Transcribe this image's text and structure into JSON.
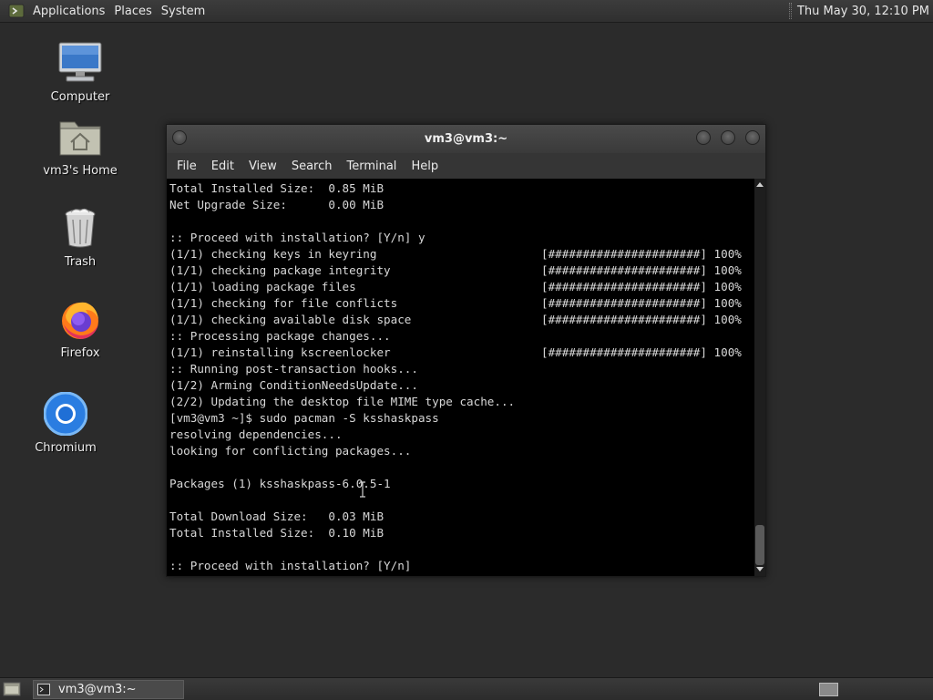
{
  "top_panel": {
    "menus": [
      "Applications",
      "Places",
      "System"
    ],
    "clock": "Thu May 30, 12:10 PM"
  },
  "desktop": {
    "icons": [
      {
        "label": "Computer",
        "icon": "computer-icon"
      },
      {
        "label": "vm3's Home",
        "icon": "home-folder-icon"
      },
      {
        "label": "Trash",
        "icon": "trash-icon"
      },
      {
        "label": "Firefox",
        "icon": "firefox-icon"
      },
      {
        "label": "Chromium",
        "icon": "chromium-icon"
      }
    ]
  },
  "window": {
    "title": "vm3@vm3:~",
    "menu": [
      "File",
      "Edit",
      "View",
      "Search",
      "Terminal",
      "Help"
    ]
  },
  "terminal": {
    "lines": [
      {
        "text": "Total Installed Size:  0.85 MiB"
      },
      {
        "text": "Net Upgrade Size:      0.00 MiB"
      },
      {
        "text": ""
      },
      {
        "text": ":: Proceed with installation? [Y/n] y"
      },
      {
        "text": "(1/1) checking keys in keyring",
        "bar": "[######################] 100%"
      },
      {
        "text": "(1/1) checking package integrity",
        "bar": "[######################] 100%"
      },
      {
        "text": "(1/1) loading package files",
        "bar": "[######################] 100%"
      },
      {
        "text": "(1/1) checking for file conflicts",
        "bar": "[######################] 100%"
      },
      {
        "text": "(1/1) checking available disk space",
        "bar": "[######################] 100%"
      },
      {
        "text": ":: Processing package changes..."
      },
      {
        "text": "(1/1) reinstalling kscreenlocker",
        "bar": "[######################] 100%"
      },
      {
        "text": ":: Running post-transaction hooks..."
      },
      {
        "text": "(1/2) Arming ConditionNeedsUpdate..."
      },
      {
        "text": "(2/2) Updating the desktop file MIME type cache..."
      },
      {
        "text": "[vm3@vm3 ~]$ sudo pacman -S ksshaskpass"
      },
      {
        "text": "resolving dependencies..."
      },
      {
        "text": "looking for conflicting packages..."
      },
      {
        "text": ""
      },
      {
        "text": "Packages (1) ksshaskpass-6.0.5-1"
      },
      {
        "text": ""
      },
      {
        "text": "Total Download Size:   0.03 MiB"
      },
      {
        "text": "Total Installed Size:  0.10 MiB"
      },
      {
        "text": ""
      },
      {
        "text": ":: Proceed with installation? [Y/n] "
      }
    ]
  },
  "taskbar": {
    "task_label": "vm3@vm3:~"
  }
}
